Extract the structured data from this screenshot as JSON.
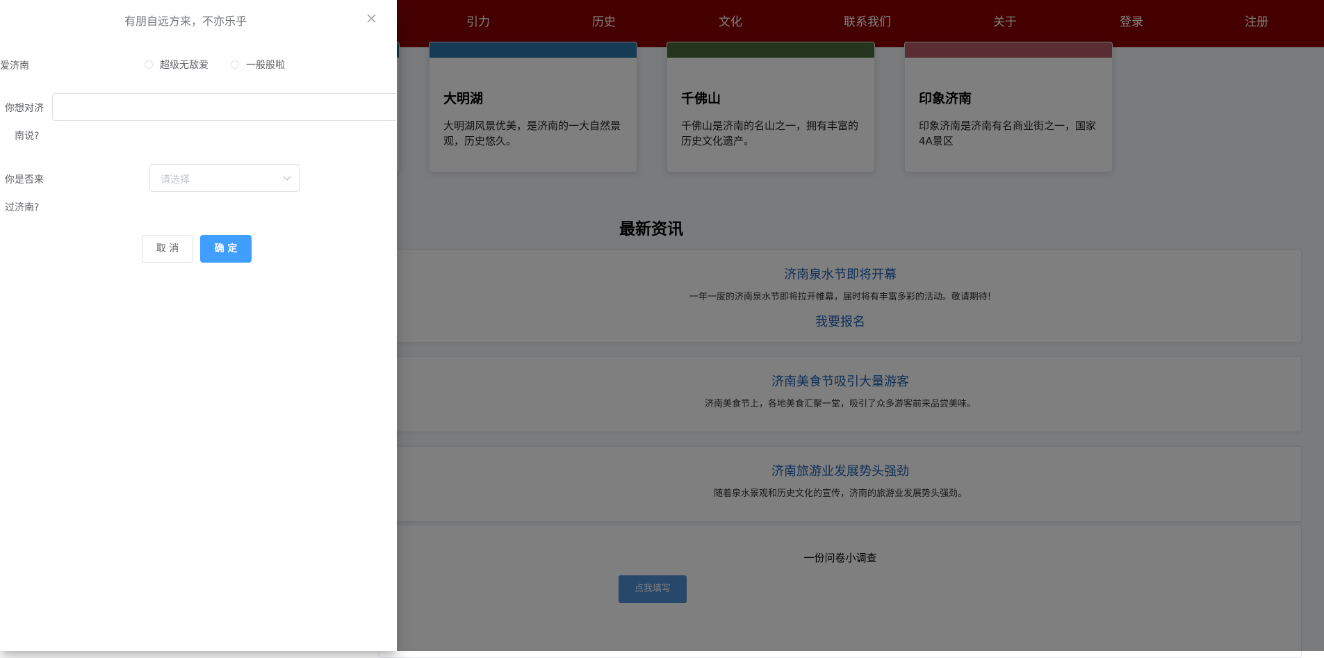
{
  "nav": {
    "items": [
      "引力",
      "历史",
      "文化",
      "联系我们",
      "关于",
      "登录",
      "注册"
    ]
  },
  "cards": [
    {
      "title": "大明湖",
      "desc": "大明湖风景优美，是济南的一大自然景观，历史悠久。"
    },
    {
      "title": "千佛山",
      "desc": "千佛山是济南的名山之一，拥有丰富的历史文化遗产。"
    },
    {
      "title": "印象济南",
      "desc": "印象济南是济南有名商业街之一，国家4A景区"
    }
  ],
  "news_section": {
    "title": "最新资讯",
    "items": [
      {
        "title": "济南泉水节即将开幕",
        "desc": "一年一度的济南泉水节即将拉开帷幕，届时将有丰富多彩的活动。敬请期待!",
        "link": "我要报名"
      },
      {
        "title": "济南美食节吸引大量游客",
        "desc": "济南美食节上，各地美食汇聚一堂，吸引了众多游客前来品尝美味。"
      },
      {
        "title": "济南旅游业发展势头强劲",
        "desc": "随着泉水景观和历史文化的宣传，济南的旅游业发展势头强劲。"
      }
    ]
  },
  "survey": {
    "text": "一份问卷小调查",
    "button": "点我填写"
  },
  "drawer": {
    "title": "有朋自远方来，不亦乐乎",
    "q1_label": "爱济南",
    "q1_options": [
      "超级无敌爱",
      "一般般啦"
    ],
    "q2_label_line1": "你想对济",
    "q2_label_line2": "南说?",
    "q2_value": "",
    "q3_label_line1": "你是否来",
    "q3_label_line2": "过济南?",
    "q3_placeholder": "请选择",
    "cancel": "取 消",
    "confirm": "确 定"
  },
  "colors": {
    "nav_bg": "#8b0000",
    "primary": "#409eff",
    "link": "#1d5fb0"
  }
}
